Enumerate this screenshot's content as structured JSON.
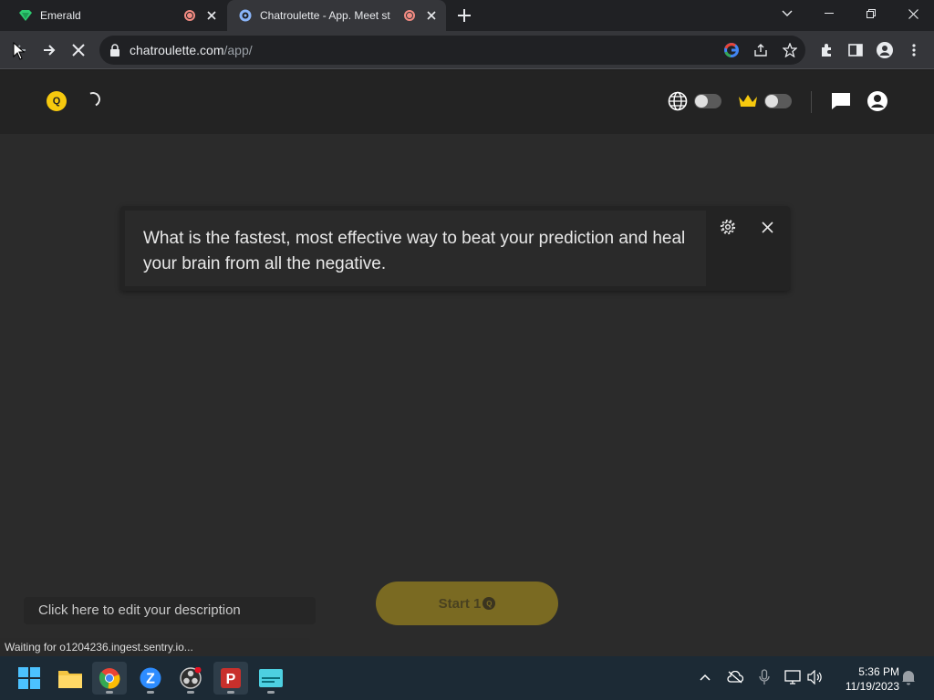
{
  "browser": {
    "tabs": [
      {
        "title": "Emerald",
        "favicon": "emerald-gem-icon",
        "recording": true,
        "active": false
      },
      {
        "title": "Chatroulette - App. Meet st",
        "favicon": "chatroulette-icon",
        "recording": true,
        "active": true
      }
    ],
    "url_domain": "chatroulette.com",
    "url_path": "/app/",
    "status_text": "Waiting for o1204236.ingest.sentry.io..."
  },
  "app": {
    "logo_letter": "Q",
    "prompt_text": "What is the fastest, most effective way to beat your prediction and heal your brain from all the negative.",
    "description_placeholder": "Click here to edit your description",
    "start_label": "Start 1",
    "coin_symbol": "Q",
    "toggles": [
      {
        "name": "language",
        "on": false
      },
      {
        "name": "premium",
        "on": false
      }
    ]
  },
  "taskbar": {
    "apps": [
      "windows-start",
      "file-explorer",
      "chrome",
      "zoom",
      "obs-studio",
      "pdf-app",
      "media-app"
    ],
    "time": "5:36 PM",
    "date": "11/19/2023"
  },
  "colors": {
    "accent_yellow": "#f6c90e",
    "start_button": "#7a6a22",
    "page_bg": "#2b2b2b"
  }
}
